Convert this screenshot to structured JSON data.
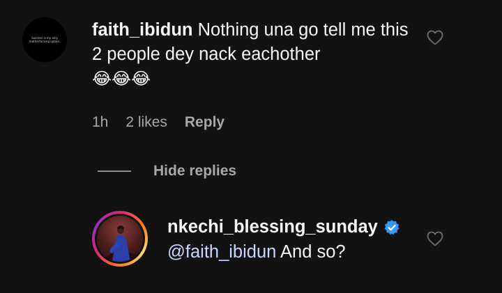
{
  "comments": [
    {
      "avatar_text": "Success is my only motherfucking option.",
      "username": "faith_ibidun",
      "text": "Nothing una go tell me this 2 people dey nack eachother",
      "emojis": "😂😂😂",
      "time": "1h",
      "likes": "2 likes",
      "reply_label": "Reply"
    }
  ],
  "hide_replies_label": "Hide replies",
  "reply": {
    "username": "nkechi_blessing_sunday",
    "verified": true,
    "mention": "@faith_ibidun",
    "text": "And so?"
  },
  "icons": {
    "like": "heart-outline-icon",
    "verified": "verified-badge-icon"
  },
  "colors": {
    "background": "#121212",
    "muted": "#a8a8a8",
    "verified": "#3897f0",
    "mention": "#c7d7ff"
  }
}
